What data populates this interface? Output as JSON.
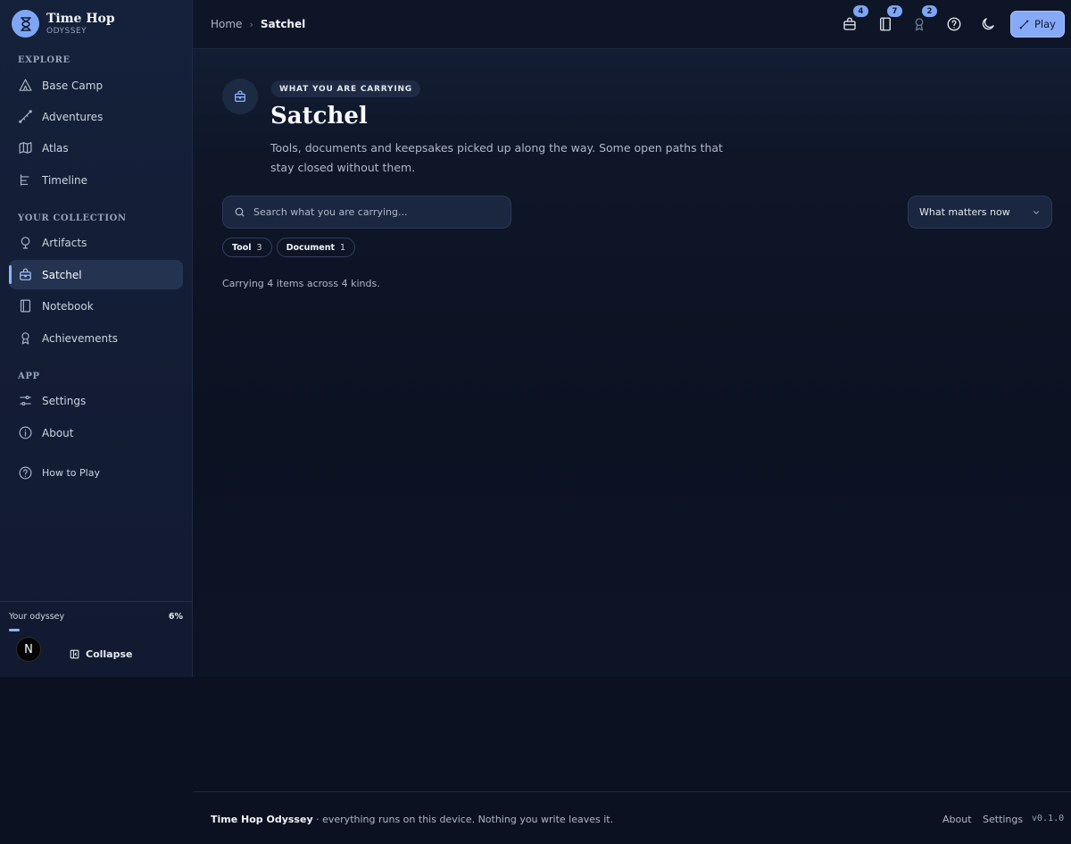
{
  "brand": {
    "title": "Time Hop",
    "subtitle": "ODYSSEY"
  },
  "sidebar": {
    "sections": [
      {
        "label": "EXPLORE",
        "items": [
          {
            "label": "Base Camp",
            "icon": "tent-icon"
          },
          {
            "label": "Adventures",
            "icon": "path-icon"
          },
          {
            "label": "Atlas",
            "icon": "map-icon"
          },
          {
            "label": "Timeline",
            "icon": "timeline-icon"
          }
        ]
      },
      {
        "label": "YOUR COLLECTION",
        "items": [
          {
            "label": "Artifacts",
            "icon": "gem-icon"
          },
          {
            "label": "Satchel",
            "icon": "satchel-icon",
            "active": true
          },
          {
            "label": "Notebook",
            "icon": "notebook-icon"
          },
          {
            "label": "Achievements",
            "icon": "award-icon"
          }
        ]
      },
      {
        "label": "APP",
        "items": [
          {
            "label": "Settings",
            "icon": "sliders-icon"
          },
          {
            "label": "About",
            "icon": "info-icon"
          },
          {
            "label": "How to Play",
            "icon": "help-icon"
          }
        ]
      }
    ],
    "progress": {
      "label": "Your odyssey",
      "value_text": "6%",
      "value": 0.06
    },
    "avatar_letter": "N",
    "collapse_label": "Collapse"
  },
  "topbar": {
    "breadcrumb": {
      "home": "Home",
      "current": "Satchel"
    },
    "badges": {
      "satchel": "4",
      "notebook": "7",
      "achievements": "2"
    },
    "play_label": "Play"
  },
  "main": {
    "eyebrow": "WHAT YOU ARE CARRYING",
    "title": "Satchel",
    "description": "Tools, documents and keepsakes picked up along the way. Some open paths that stay closed without them.",
    "search_placeholder": "Search what you are carrying...",
    "sort_value": "What matters now",
    "chips": [
      {
        "label": "Tool",
        "count": "3"
      },
      {
        "label": "Document",
        "count": "1"
      }
    ],
    "summary": "Carrying 4 items across 4 kinds."
  },
  "footer": {
    "app_name": "Time Hop Odyssey",
    "tagline": " · everything runs on this device. Nothing you write leaves it.",
    "links": {
      "about": "About",
      "settings": "Settings"
    },
    "version": "v0.1.0"
  },
  "colors": {
    "accent": "#86aaf7",
    "background": "#0b1120",
    "sidebar": "#15203a"
  }
}
